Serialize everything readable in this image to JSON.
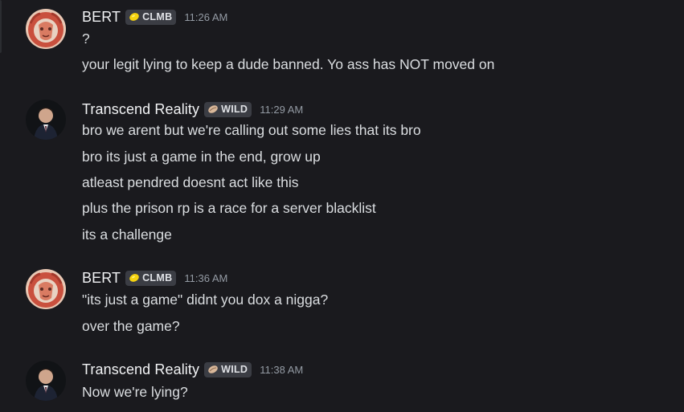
{
  "messages": [
    {
      "username": "BERT",
      "tag": "CLMB",
      "tag_icon": "lemon-icon",
      "time": "11:26 AM",
      "lines": [
        "?",
        "your legit lying to keep a dude banned. Yo ass has NOT moved on"
      ]
    },
    {
      "username": "Transcend Reality",
      "tag": "WILD",
      "tag_icon": "seed-icon",
      "time": "11:29 AM",
      "lines": [
        "bro we arent but we're calling out some lies that its bro",
        "bro its just a game in the end, grow up",
        "atleast pendred doesnt act like this",
        "plus the prison rp is a race for a server blacklist",
        "its a challenge"
      ]
    },
    {
      "username": "BERT",
      "tag": "CLMB",
      "tag_icon": "lemon-icon",
      "time": "11:36 AM",
      "lines": [
        "\"its just a game\" didnt you dox a nigga?",
        "over the game?"
      ]
    },
    {
      "username": "Transcend Reality",
      "tag": "WILD",
      "tag_icon": "seed-icon",
      "time": "11:38 AM",
      "lines": [
        "Now we're lying?"
      ]
    }
  ],
  "colors": {
    "background": "#1a1a1e",
    "username": "#f2f3f5",
    "message_text": "#dbdee1",
    "timestamp": "#949ba4",
    "tag_background": "#3b3d44"
  }
}
